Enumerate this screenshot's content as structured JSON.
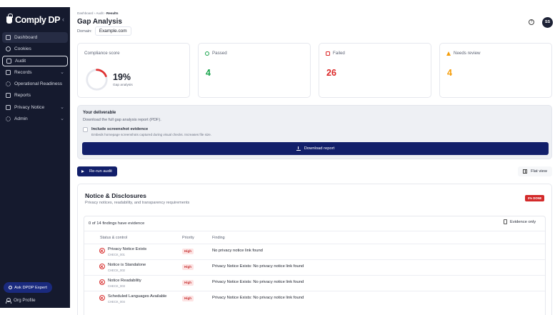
{
  "brand": {
    "name": "Comply DP"
  },
  "sidebar": {
    "collapse_glyph": "‹",
    "items": [
      {
        "label": "Dashboard",
        "icon": "dashboard-icon"
      },
      {
        "label": "Cookies",
        "icon": "cookie-icon"
      },
      {
        "label": "Audit",
        "icon": "audit-icon"
      },
      {
        "label": "Records",
        "icon": "folder-icon",
        "chevron": "⌄"
      },
      {
        "label": "Operational Readiness",
        "icon": "gear-icon"
      },
      {
        "label": "Reports",
        "icon": "report-icon"
      },
      {
        "label": "Privacy Notice",
        "icon": "notice-icon",
        "chevron": "⌄"
      },
      {
        "label": "Admin",
        "icon": "admin-gear-icon",
        "chevron": "⌄"
      }
    ],
    "ask_label": "Ask DPDP Expert",
    "org_profile": "Org Profile"
  },
  "header": {
    "breadcrumb": [
      "Dashboard",
      "Audit",
      "Results"
    ],
    "title": "Gap Analysis",
    "domain_label": "Domain:",
    "domain_value": "Example.com",
    "help_glyph": "?",
    "avatar_initials": "SS"
  },
  "stats": {
    "compliance": {
      "label": "Compliance score",
      "value": "19%",
      "sub": "Gap analysis",
      "fraction": 0.19
    },
    "passed": {
      "label": "Passed",
      "value": "4",
      "color": "#16a34a"
    },
    "failed": {
      "label": "Failed",
      "value": "26",
      "color": "#dc2626"
    },
    "review": {
      "label": "Needs review",
      "value": "4",
      "color": "#f59e0b"
    }
  },
  "deliverable": {
    "heading": "Your deliverable",
    "sub": "Download the full gap analysis report (PDF).",
    "checkbox_label": "Include screenshot evidence",
    "checkbox_sub": "Embeds homepage screenshots captured during visual checks. Increases file size.",
    "download_label": "Download report"
  },
  "actions": {
    "rerun_label": "Re-run audit",
    "flat_view_label": "Flat view"
  },
  "section": {
    "title": "Notice & Disclosures",
    "subtitle": "Privacy notices, readability, and transparency requirements",
    "risk_badge": "0% DONE",
    "count_text": "0 of 14 findings have evidence",
    "evidence_only_label": "Evidence only",
    "columns": [
      "Status & control",
      "Priority",
      "Finding"
    ],
    "rows": [
      {
        "control": "Privacy Notice Exists",
        "id": "CHECK_001",
        "priority": "High",
        "finding": "No privacy notice link found"
      },
      {
        "control": "Notice is Standalone",
        "id": "CHECK_002",
        "priority": "High",
        "finding": "Privacy Notice Exists: No privacy notice link found"
      },
      {
        "control": "Notice Readability",
        "id": "CHECK_003",
        "priority": "High",
        "finding": "Privacy Notice Exists: No privacy notice link found"
      },
      {
        "control": "Scheduled Languages Available",
        "id": "CHECK_004",
        "priority": "High",
        "finding": "Privacy Notice Exists: No privacy notice link found"
      }
    ]
  }
}
